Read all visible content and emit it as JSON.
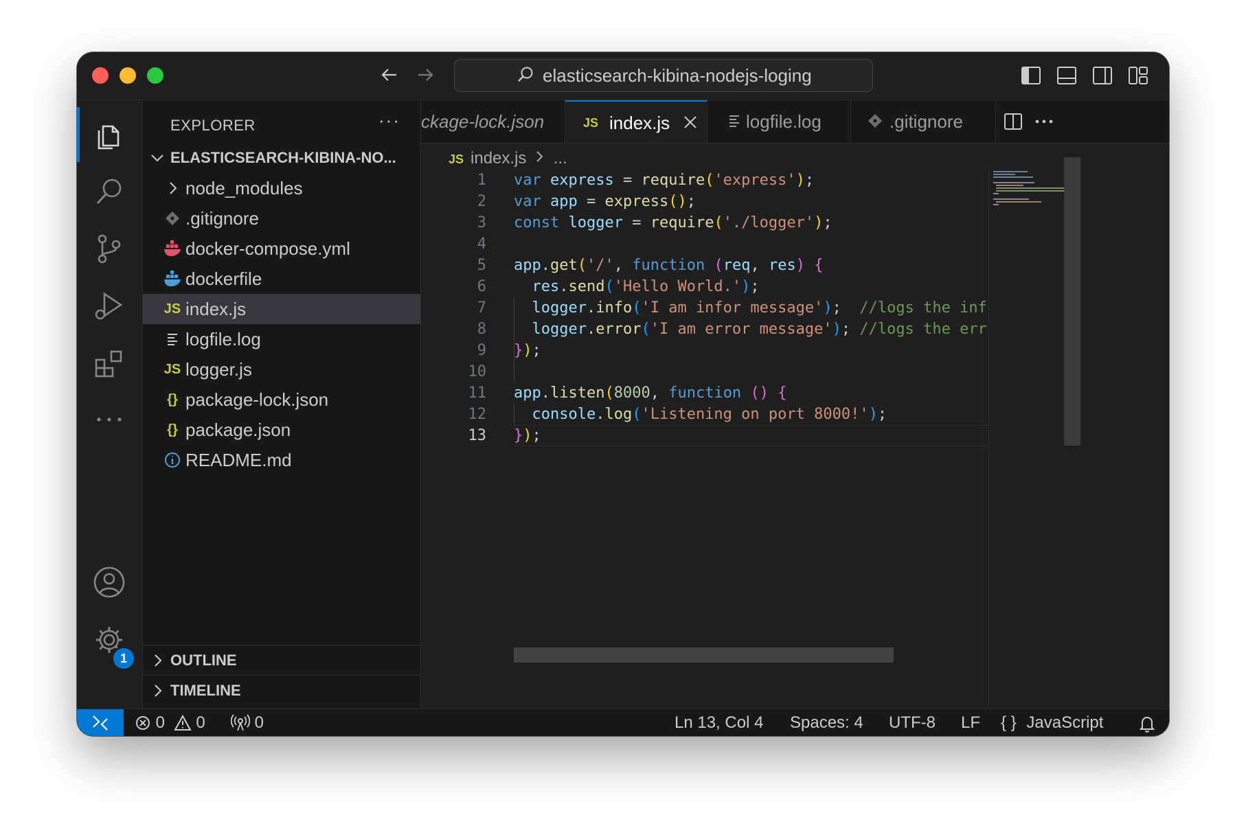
{
  "window": {
    "title": "elasticsearch-kibina-nodejs-loging"
  },
  "sidebar": {
    "title": "EXPLORER",
    "more": "···",
    "folder": "ELASTICSEARCH-KIBINA-NO...",
    "files": [
      {
        "name": "node_modules",
        "icon": "chevron-right-icon"
      },
      {
        "name": ".gitignore",
        "icon": "git-icon"
      },
      {
        "name": "docker-compose.yml",
        "icon": "docker-icon"
      },
      {
        "name": "dockerfile",
        "icon": "docker-icon"
      },
      {
        "name": "index.js",
        "icon": "js-icon",
        "selected": true
      },
      {
        "name": "logfile.log",
        "icon": "log-file-icon"
      },
      {
        "name": "logger.js",
        "icon": "js-icon"
      },
      {
        "name": "package-lock.json",
        "icon": "json-icon"
      },
      {
        "name": "package.json",
        "icon": "json-icon"
      },
      {
        "name": "README.md",
        "icon": "info-icon"
      }
    ],
    "sections": [
      "OUTLINE",
      "TIMELINE"
    ]
  },
  "icons": {
    "js": "JS",
    "json": "{}"
  },
  "tabs": [
    {
      "label": "ckage-lock.json",
      "active": false
    },
    {
      "label": "index.js",
      "active": true
    },
    {
      "label": "logfile.log",
      "active": false
    },
    {
      "label": ".gitignore",
      "active": false
    }
  ],
  "breadcrumb": {
    "file": "index.js",
    "more": "..."
  },
  "editor": {
    "current_line": 13,
    "line_numbers": [
      "1",
      "2",
      "3",
      "4",
      "5",
      "6",
      "7",
      "8",
      "9",
      "10",
      "11",
      "12",
      "13"
    ],
    "lines": [
      "var express = require('express');",
      "var app = express();",
      "const logger = require('./logger');",
      "",
      "app.get('/', function (req, res) {",
      "  res.send('Hello World.');",
      "  logger.info('I am infor message');  //logs the info lo",
      "  logger.error('I am error message'); //logs the error l",
      "});",
      "",
      "app.listen(8000, function () {",
      "  console.log('Listening on port 8000!');",
      "});"
    ]
  },
  "activity_badge": "1",
  "status": {
    "errors": "0",
    "warnings": "0",
    "ports": "0",
    "position": "Ln 13, Col 4",
    "spaces": "Spaces: 4",
    "encoding": "UTF-8",
    "eol": "LF",
    "language_icon": "{ }",
    "language": "JavaScript"
  },
  "colors": {
    "accent": "#0078d4",
    "js_icon": "#cbcb41",
    "json_icon": "#cbcb41",
    "docker_red": "#e0526d",
    "docker_blue": "#4a9fd8"
  }
}
